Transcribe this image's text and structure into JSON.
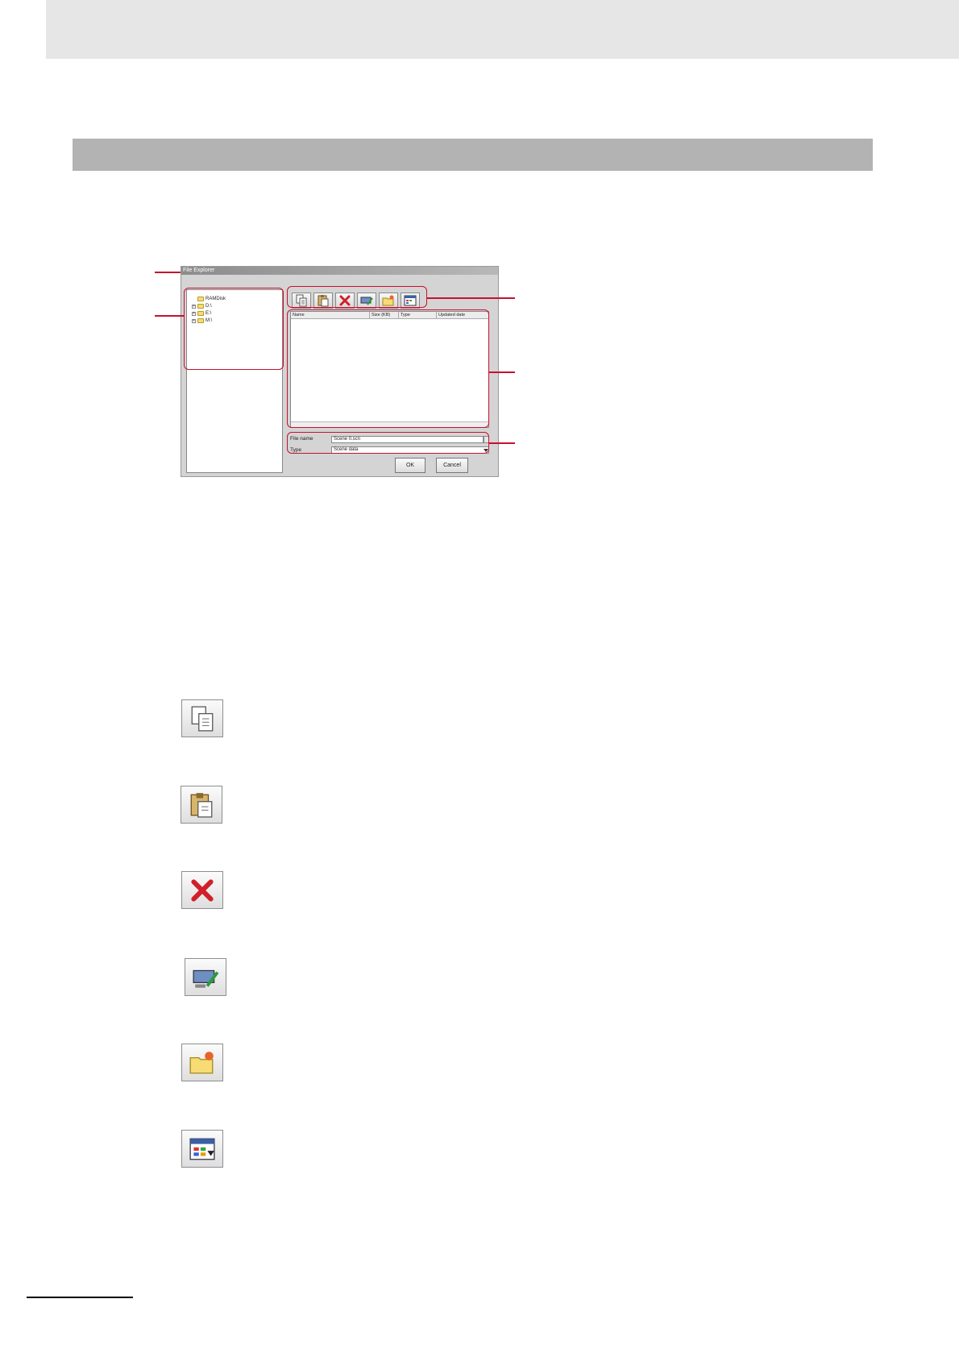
{
  "dialog": {
    "title": "File Explorer",
    "tree": [
      {
        "label": "RAMDisk",
        "expandable": false
      },
      {
        "label": "D:\\",
        "expandable": true
      },
      {
        "label": "E:\\",
        "expandable": true
      },
      {
        "label": "M:\\",
        "expandable": true
      }
    ],
    "toolbar_icons": [
      "copy-icon",
      "paste-icon",
      "delete-icon",
      "rename-icon",
      "new-folder-icon",
      "view-style-icon"
    ],
    "columns": [
      "Name",
      "Size (KB)",
      "Type",
      "Updated date"
    ],
    "file_name_label": "File name",
    "file_name_value": "Scene 0.scn",
    "type_label": "Type",
    "type_value": "Scene data",
    "ok_label": "OK",
    "cancel_label": "Cancel"
  },
  "colors": {
    "highlight": "#c8102e",
    "section_bar": "#b3b3b3",
    "top_band": "#e6e6e6"
  },
  "icon_list": [
    "copy-icon",
    "paste-icon",
    "delete-icon",
    "rename-icon",
    "new-folder-icon",
    "view-style-icon"
  ]
}
